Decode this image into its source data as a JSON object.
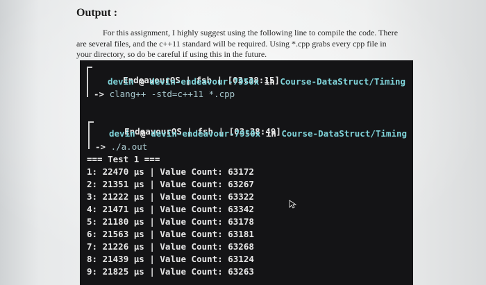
{
  "heading": "Output :",
  "paragraph": [
    "For this assignment, I highly suggest using the following line to compile the code. There",
    "are several files, and the c++11 standard will be required. Using *.cpp grabs every cpp file in",
    "your directory, so do be careful if using this in the future."
  ],
  "terminal": {
    "block1": {
      "header": "EndeavourOS | fsh | [03:38:15]",
      "user": "devin",
      "at": "@",
      "host": "devin-endeavour-7950x",
      "in": "in",
      "path": "Course-DataStruct/Timing",
      "arrow": "->",
      "command": "clang++ -std=c++11 *.cpp"
    },
    "block2": {
      "header": "EndeavourOS | fsh | [03:38:49]",
      "user": "devin",
      "at": "@",
      "host": "devin-endeavour-7950x",
      "in": "in",
      "path": "Course-DataStruct/Timing",
      "arrow": "->",
      "command": "./a.out"
    },
    "test_header": "=== Test 1 ===",
    "results": [
      {
        "index": "1:",
        "time": "22470 µs",
        "sep": "|",
        "label": "Value Count:",
        "count": "63172"
      },
      {
        "index": "2:",
        "time": "21351 µs",
        "sep": "|",
        "label": "Value Count:",
        "count": "63267"
      },
      {
        "index": "3:",
        "time": "21222 µs",
        "sep": "|",
        "label": "Value Count:",
        "count": "63322"
      },
      {
        "index": "4:",
        "time": "21471 µs",
        "sep": "|",
        "label": "Value Count:",
        "count": "63342"
      },
      {
        "index": "5:",
        "time": "21180 µs",
        "sep": "|",
        "label": "Value Count:",
        "count": "63178"
      },
      {
        "index": "6:",
        "time": "21563 µs",
        "sep": "|",
        "label": "Value Count:",
        "count": "63181"
      },
      {
        "index": "7:",
        "time": "21226 µs",
        "sep": "|",
        "label": "Value Count:",
        "count": "63268"
      },
      {
        "index": "8:",
        "time": "21439 µs",
        "sep": "|",
        "label": "Value Count:",
        "count": "63124"
      },
      {
        "index": "9:",
        "time": "21825 µs",
        "sep": "|",
        "label": "Value Count:",
        "count": "63263"
      }
    ]
  },
  "colors": {
    "terminal_bg": "#141416",
    "cyan": "#7fd3d9",
    "text": "#e6e6e6"
  },
  "icons": {
    "cursor": "mouse-pointer-icon"
  }
}
